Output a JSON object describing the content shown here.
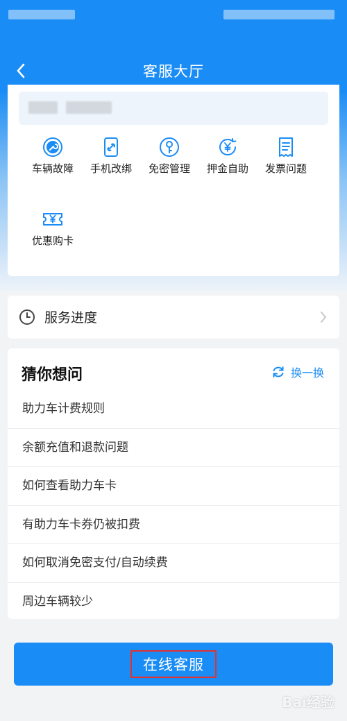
{
  "header": {
    "title": "客服大厅",
    "back_icon": "chevron-left-icon"
  },
  "quick_actions": [
    {
      "label": "车辆故障",
      "icon": "wrench-icon"
    },
    {
      "label": "手机改绑",
      "icon": "phone-link-icon"
    },
    {
      "label": "免密管理",
      "icon": "key-circle-icon"
    },
    {
      "label": "押金自助",
      "icon": "yen-refresh-icon"
    },
    {
      "label": "发票问题",
      "icon": "receipt-icon"
    },
    {
      "label": "优惠购卡",
      "icon": "yen-ticket-icon"
    }
  ],
  "service_progress": {
    "label": "服务进度"
  },
  "faq": {
    "title": "猜你想问",
    "refresh_label": "换一换",
    "items": [
      "助力车计费规则",
      "余额充值和退款问题",
      "如何查看助力车卡",
      "有助力车卡券仍被扣费",
      "如何取消免密支付/自动续费",
      "周边车辆较少"
    ]
  },
  "online_service": {
    "label": "在线客服"
  },
  "watermark": {
    "text": "Bai经验"
  },
  "colors": {
    "primary": "#1a8cf5",
    "highlight_border": "#e0332f"
  }
}
